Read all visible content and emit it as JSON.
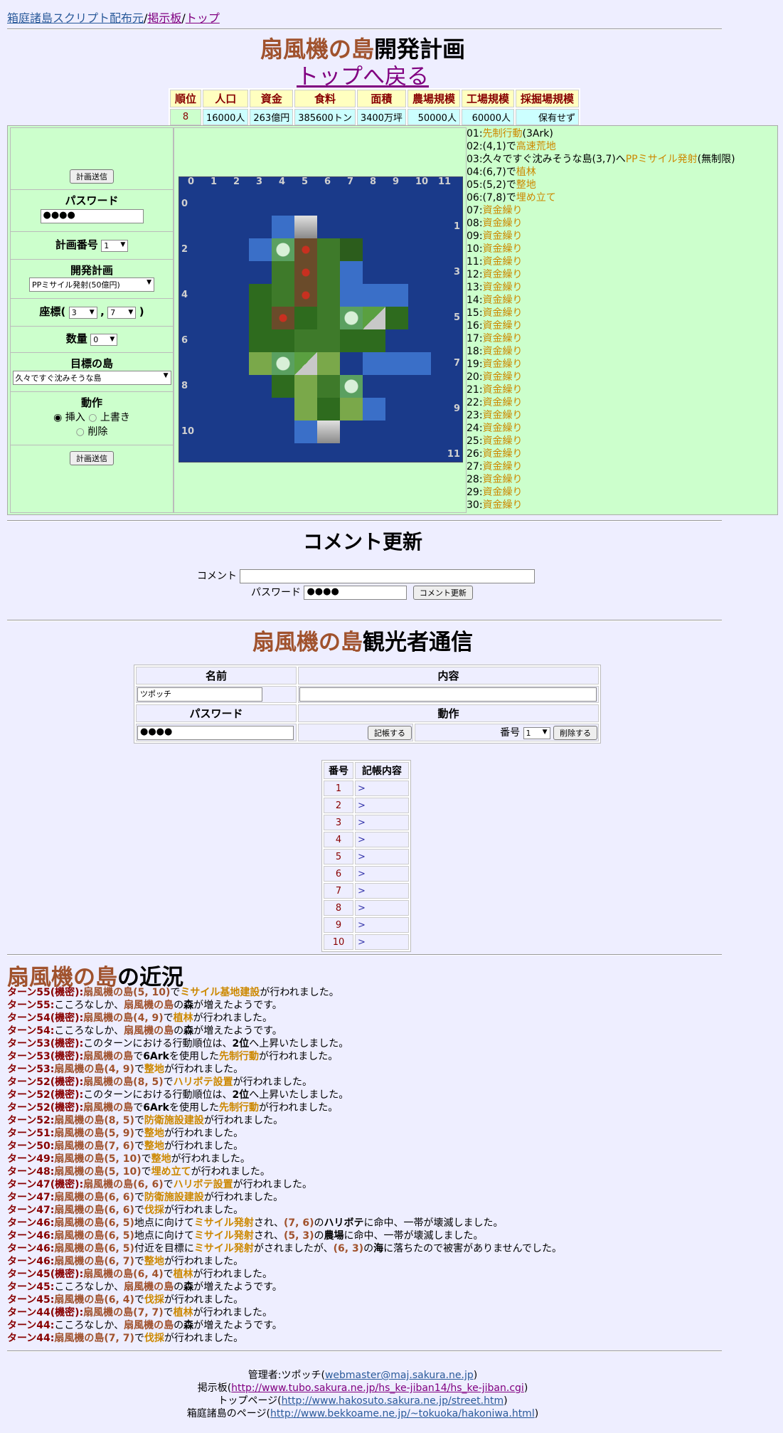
{
  "nav": {
    "link1": "箱庭諸島スクリプト配布元",
    "link2": "掲示板",
    "link3": "トップ",
    "sep": "/"
  },
  "page": {
    "island": "扇風機の島",
    "title_suffix": "開発計画",
    "back_link": "トップへ戻る"
  },
  "stats": {
    "headers": [
      "順位",
      "人口",
      "資金",
      "食料",
      "面積",
      "農場規模",
      "工場規模",
      "採掘場規模"
    ],
    "values": [
      "8",
      "16000人",
      "263億円",
      "385600トン",
      "3400万坪",
      "50000人",
      "60000人",
      "保有せず"
    ]
  },
  "form": {
    "send_label": "計画送信",
    "password_label": "パスワード",
    "password_value": "●●●●",
    "plan_no_label": "計画番号",
    "plan_no_value": "1",
    "dev_plan_label": "開発計画",
    "dev_plan_value": "PPミサイル発射(50億円)",
    "coord_label": "座標(",
    "coord_x": "3",
    "coord_comma": ",",
    "coord_y": "7",
    "coord_close": ")",
    "qty_label": "数量",
    "qty_value": "0",
    "target_label": "目標の島",
    "target_value": "久々ですぐ沈みそうな島",
    "action_label": "動作",
    "insert": "挿入",
    "overwrite": "上書き",
    "delete": "削除"
  },
  "map": {
    "x_labels": [
      "0",
      "1",
      "2",
      "3",
      "4",
      "5",
      "6",
      "7",
      "8",
      "9",
      "10",
      "11"
    ],
    "y_labels": [
      "0",
      "1",
      "2",
      "3",
      "4",
      "5",
      "6",
      "7",
      "8",
      "9",
      "10",
      "11"
    ]
  },
  "plans": [
    {
      "no": "01:",
      "pre": "",
      "cmd": "先制行動",
      "post": "(3Ark)"
    },
    {
      "no": "02:",
      "pre": "(4,1)で",
      "cmd": "高速荒地",
      "post": ""
    },
    {
      "no": "03:",
      "pre": "久々ですぐ沈みそうな島(3,7)へ",
      "cmd": "PPミサイル発射",
      "post": "(無制限)"
    },
    {
      "no": "04:",
      "pre": "(6,7)で",
      "cmd": "植林",
      "post": ""
    },
    {
      "no": "05:",
      "pre": "(5,2)で",
      "cmd": "整地",
      "post": ""
    },
    {
      "no": "06:",
      "pre": "(7,8)で",
      "cmd": "埋め立て",
      "post": ""
    },
    {
      "no": "07:",
      "pre": "",
      "cmd": "資金繰り",
      "post": ""
    },
    {
      "no": "08:",
      "pre": "",
      "cmd": "資金繰り",
      "post": ""
    },
    {
      "no": "09:",
      "pre": "",
      "cmd": "資金繰り",
      "post": ""
    },
    {
      "no": "10:",
      "pre": "",
      "cmd": "資金繰り",
      "post": ""
    },
    {
      "no": "11:",
      "pre": "",
      "cmd": "資金繰り",
      "post": ""
    },
    {
      "no": "12:",
      "pre": "",
      "cmd": "資金繰り",
      "post": ""
    },
    {
      "no": "13:",
      "pre": "",
      "cmd": "資金繰り",
      "post": ""
    },
    {
      "no": "14:",
      "pre": "",
      "cmd": "資金繰り",
      "post": ""
    },
    {
      "no": "15:",
      "pre": "",
      "cmd": "資金繰り",
      "post": ""
    },
    {
      "no": "16:",
      "pre": "",
      "cmd": "資金繰り",
      "post": ""
    },
    {
      "no": "17:",
      "pre": "",
      "cmd": "資金繰り",
      "post": ""
    },
    {
      "no": "18:",
      "pre": "",
      "cmd": "資金繰り",
      "post": ""
    },
    {
      "no": "19:",
      "pre": "",
      "cmd": "資金繰り",
      "post": ""
    },
    {
      "no": "20:",
      "pre": "",
      "cmd": "資金繰り",
      "post": ""
    },
    {
      "no": "21:",
      "pre": "",
      "cmd": "資金繰り",
      "post": ""
    },
    {
      "no": "22:",
      "pre": "",
      "cmd": "資金繰り",
      "post": ""
    },
    {
      "no": "23:",
      "pre": "",
      "cmd": "資金繰り",
      "post": ""
    },
    {
      "no": "24:",
      "pre": "",
      "cmd": "資金繰り",
      "post": ""
    },
    {
      "no": "25:",
      "pre": "",
      "cmd": "資金繰り",
      "post": ""
    },
    {
      "no": "26:",
      "pre": "",
      "cmd": "資金繰り",
      "post": ""
    },
    {
      "no": "27:",
      "pre": "",
      "cmd": "資金繰り",
      "post": ""
    },
    {
      "no": "28:",
      "pre": "",
      "cmd": "資金繰り",
      "post": ""
    },
    {
      "no": "29:",
      "pre": "",
      "cmd": "資金繰り",
      "post": ""
    },
    {
      "no": "30:",
      "pre": "",
      "cmd": "資金繰り",
      "post": ""
    }
  ],
  "comment": {
    "title": "コメント更新",
    "comment_label": "コメント",
    "password_label": "パスワード",
    "password_value": "●●●●",
    "button": "コメント更新"
  },
  "visitor": {
    "title_suffix": "観光者通信",
    "name_header": "名前",
    "content_header": "内容",
    "name_value": "ツポッチ",
    "password_header": "パスワード",
    "action_header": "動作",
    "password_value": "●●●●",
    "post_button": "記帳する",
    "no_label": "番号",
    "no_value": "1",
    "delete_button": "削除する"
  },
  "log_table": {
    "headers": [
      "番号",
      "記帳内容"
    ],
    "rows": [
      "1",
      "2",
      "3",
      "4",
      "5",
      "6",
      "7",
      "8",
      "9",
      "10"
    ],
    "marker": ">"
  },
  "recent": {
    "suffix": "の近況"
  },
  "history": [
    [
      [
        "t",
        "ターン55(機密):"
      ],
      [
        "i",
        "扇風機の島(5, 10)"
      ],
      [
        "n",
        "で"
      ],
      [
        "o",
        "ミサイル基地建設"
      ],
      [
        "n",
        "が行われました。"
      ]
    ],
    [
      [
        "t",
        "ターン55:"
      ],
      [
        "n",
        "こころなしか、"
      ],
      [
        "i",
        "扇風機の島"
      ],
      [
        "n",
        "の"
      ],
      [
        "b",
        "森"
      ],
      [
        "n",
        "が増えたようです。"
      ]
    ],
    [
      [
        "t",
        "ターン54(機密):"
      ],
      [
        "i",
        "扇風機の島(4, 9)"
      ],
      [
        "n",
        "で"
      ],
      [
        "o",
        "植林"
      ],
      [
        "n",
        "が行われました。"
      ]
    ],
    [
      [
        "t",
        "ターン54:"
      ],
      [
        "n",
        "こころなしか、"
      ],
      [
        "i",
        "扇風機の島"
      ],
      [
        "n",
        "の"
      ],
      [
        "b",
        "森"
      ],
      [
        "n",
        "が増えたようです。"
      ]
    ],
    [
      [
        "t",
        "ターン53(機密):"
      ],
      [
        "n",
        "このターンにおける行動順位は、"
      ],
      [
        "b",
        "2位"
      ],
      [
        "n",
        "へ上昇いたしました。"
      ]
    ],
    [
      [
        "t",
        "ターン53(機密):"
      ],
      [
        "i",
        "扇風機の島"
      ],
      [
        "n",
        "で"
      ],
      [
        "b",
        "6Ark"
      ],
      [
        "n",
        "を使用した"
      ],
      [
        "o",
        "先制行動"
      ],
      [
        "n",
        "が行われました。"
      ]
    ],
    [
      [
        "t",
        "ターン53:"
      ],
      [
        "i",
        "扇風機の島(4, 9)"
      ],
      [
        "n",
        "で"
      ],
      [
        "o",
        "整地"
      ],
      [
        "n",
        "が行われました。"
      ]
    ],
    [
      [
        "t",
        "ターン52(機密):"
      ],
      [
        "i",
        "扇風機の島(8, 5)"
      ],
      [
        "n",
        "で"
      ],
      [
        "o",
        "ハリボテ設置"
      ],
      [
        "n",
        "が行われました。"
      ]
    ],
    [
      [
        "t",
        "ターン52(機密):"
      ],
      [
        "n",
        "このターンにおける行動順位は、"
      ],
      [
        "b",
        "2位"
      ],
      [
        "n",
        "へ上昇いたしました。"
      ]
    ],
    [
      [
        "t",
        "ターン52(機密):"
      ],
      [
        "i",
        "扇風機の島"
      ],
      [
        "n",
        "で"
      ],
      [
        "b",
        "6Ark"
      ],
      [
        "n",
        "を使用した"
      ],
      [
        "o",
        "先制行動"
      ],
      [
        "n",
        "が行われました。"
      ]
    ],
    [
      [
        "t",
        "ターン52:"
      ],
      [
        "i",
        "扇風機の島(8, 5)"
      ],
      [
        "n",
        "で"
      ],
      [
        "o",
        "防衛施設建設"
      ],
      [
        "n",
        "が行われました。"
      ]
    ],
    [
      [
        "t",
        "ターン51:"
      ],
      [
        "i",
        "扇風機の島(5, 9)"
      ],
      [
        "n",
        "で"
      ],
      [
        "o",
        "整地"
      ],
      [
        "n",
        "が行われました。"
      ]
    ],
    [
      [
        "t",
        "ターン50:"
      ],
      [
        "i",
        "扇風機の島(7, 6)"
      ],
      [
        "n",
        "で"
      ],
      [
        "o",
        "整地"
      ],
      [
        "n",
        "が行われました。"
      ]
    ],
    [
      [
        "t",
        "ターン49:"
      ],
      [
        "i",
        "扇風機の島(5, 10)"
      ],
      [
        "n",
        "で"
      ],
      [
        "o",
        "整地"
      ],
      [
        "n",
        "が行われました。"
      ]
    ],
    [
      [
        "t",
        "ターン48:"
      ],
      [
        "i",
        "扇風機の島(5, 10)"
      ],
      [
        "n",
        "で"
      ],
      [
        "o",
        "埋め立て"
      ],
      [
        "n",
        "が行われました。"
      ]
    ],
    [
      [
        "t",
        "ターン47(機密):"
      ],
      [
        "i",
        "扇風機の島(6, 6)"
      ],
      [
        "n",
        "で"
      ],
      [
        "o",
        "ハリボテ設置"
      ],
      [
        "n",
        "が行われました。"
      ]
    ],
    [
      [
        "t",
        "ターン47:"
      ],
      [
        "i",
        "扇風機の島(6, 6)"
      ],
      [
        "n",
        "で"
      ],
      [
        "o",
        "防衛施設建設"
      ],
      [
        "n",
        "が行われました。"
      ]
    ],
    [
      [
        "t",
        "ターン47:"
      ],
      [
        "i",
        "扇風機の島(6, 6)"
      ],
      [
        "n",
        "で"
      ],
      [
        "o",
        "伐採"
      ],
      [
        "n",
        "が行われました。"
      ]
    ],
    [
      [
        "t",
        "ターン46:"
      ],
      [
        "i",
        "扇風機の島(6, 5)"
      ],
      [
        "n",
        "地点に向けて"
      ],
      [
        "o",
        "ミサイル発射"
      ],
      [
        "n",
        "され、"
      ],
      [
        "i",
        "(7, 6)"
      ],
      [
        "n",
        "の"
      ],
      [
        "b",
        "ハリボテ"
      ],
      [
        "n",
        "に命中、一帯が壊滅しました。"
      ]
    ],
    [
      [
        "t",
        "ターン46:"
      ],
      [
        "i",
        "扇風機の島(6, 5)"
      ],
      [
        "n",
        "地点に向けて"
      ],
      [
        "o",
        "ミサイル発射"
      ],
      [
        "n",
        "され、"
      ],
      [
        "i",
        "(5, 3)"
      ],
      [
        "n",
        "の"
      ],
      [
        "b",
        "農場"
      ],
      [
        "n",
        "に命中、一帯が壊滅しました。"
      ]
    ],
    [
      [
        "t",
        "ターン46:"
      ],
      [
        "i",
        "扇風機の島(6, 5)"
      ],
      [
        "n",
        "付近を目標に"
      ],
      [
        "o",
        "ミサイル発射"
      ],
      [
        "n",
        "がされましたが、"
      ],
      [
        "i",
        "(6, 3)"
      ],
      [
        "n",
        "の"
      ],
      [
        "b",
        "海"
      ],
      [
        "n",
        "に落ちたので被害がありませんでした。"
      ]
    ],
    [
      [
        "t",
        "ターン46:"
      ],
      [
        "i",
        "扇風機の島(6, 7)"
      ],
      [
        "n",
        "で"
      ],
      [
        "o",
        "整地"
      ],
      [
        "n",
        "が行われました。"
      ]
    ],
    [
      [
        "t",
        "ターン45(機密):"
      ],
      [
        "i",
        "扇風機の島(6, 4)"
      ],
      [
        "n",
        "で"
      ],
      [
        "o",
        "植林"
      ],
      [
        "n",
        "が行われました。"
      ]
    ],
    [
      [
        "t",
        "ターン45:"
      ],
      [
        "n",
        "こころなしか、"
      ],
      [
        "i",
        "扇風機の島"
      ],
      [
        "n",
        "の"
      ],
      [
        "b",
        "森"
      ],
      [
        "n",
        "が増えたようです。"
      ]
    ],
    [
      [
        "t",
        "ターン45:"
      ],
      [
        "i",
        "扇風機の島(6, 4)"
      ],
      [
        "n",
        "で"
      ],
      [
        "o",
        "伐採"
      ],
      [
        "n",
        "が行われました。"
      ]
    ],
    [
      [
        "t",
        "ターン44(機密):"
      ],
      [
        "i",
        "扇風機の島(7, 7)"
      ],
      [
        "n",
        "で"
      ],
      [
        "o",
        "植林"
      ],
      [
        "n",
        "が行われました。"
      ]
    ],
    [
      [
        "t",
        "ターン44:"
      ],
      [
        "n",
        "こころなしか、"
      ],
      [
        "i",
        "扇風機の島"
      ],
      [
        "n",
        "の"
      ],
      [
        "b",
        "森"
      ],
      [
        "n",
        "が増えたようです。"
      ]
    ],
    [
      [
        "t",
        "ターン44:"
      ],
      [
        "i",
        "扇風機の島(7, 7)"
      ],
      [
        "n",
        "で"
      ],
      [
        "o",
        "伐採"
      ],
      [
        "n",
        "が行われました。"
      ]
    ]
  ],
  "footer": {
    "admin_label": "管理者:ツポッチ(",
    "admin_email": "webmaster@maj.sakura.ne.jp",
    "bbs_label": "掲示板(",
    "bbs_url": "http://www.tubo.sakura.ne.jp/hs_ke-jiban14/hs_ke-jiban.cgi",
    "top_label": "トップページ(",
    "top_url": "http://www.hakosuto.sakura.ne.jp/street.htm",
    "hako_label": "箱庭諸島のページ(",
    "hako_url": "http://www.bekkoame.ne.jp/~tokuoka/hakoniwa.html",
    "close": ")"
  },
  "colors": {
    "island_name": "#a0522d",
    "command": "#cc8800",
    "turn": "#880000",
    "panel_bg": "#ccffcc",
    "page_bg": "#eeeeff",
    "sea": "#1a3a8a"
  }
}
